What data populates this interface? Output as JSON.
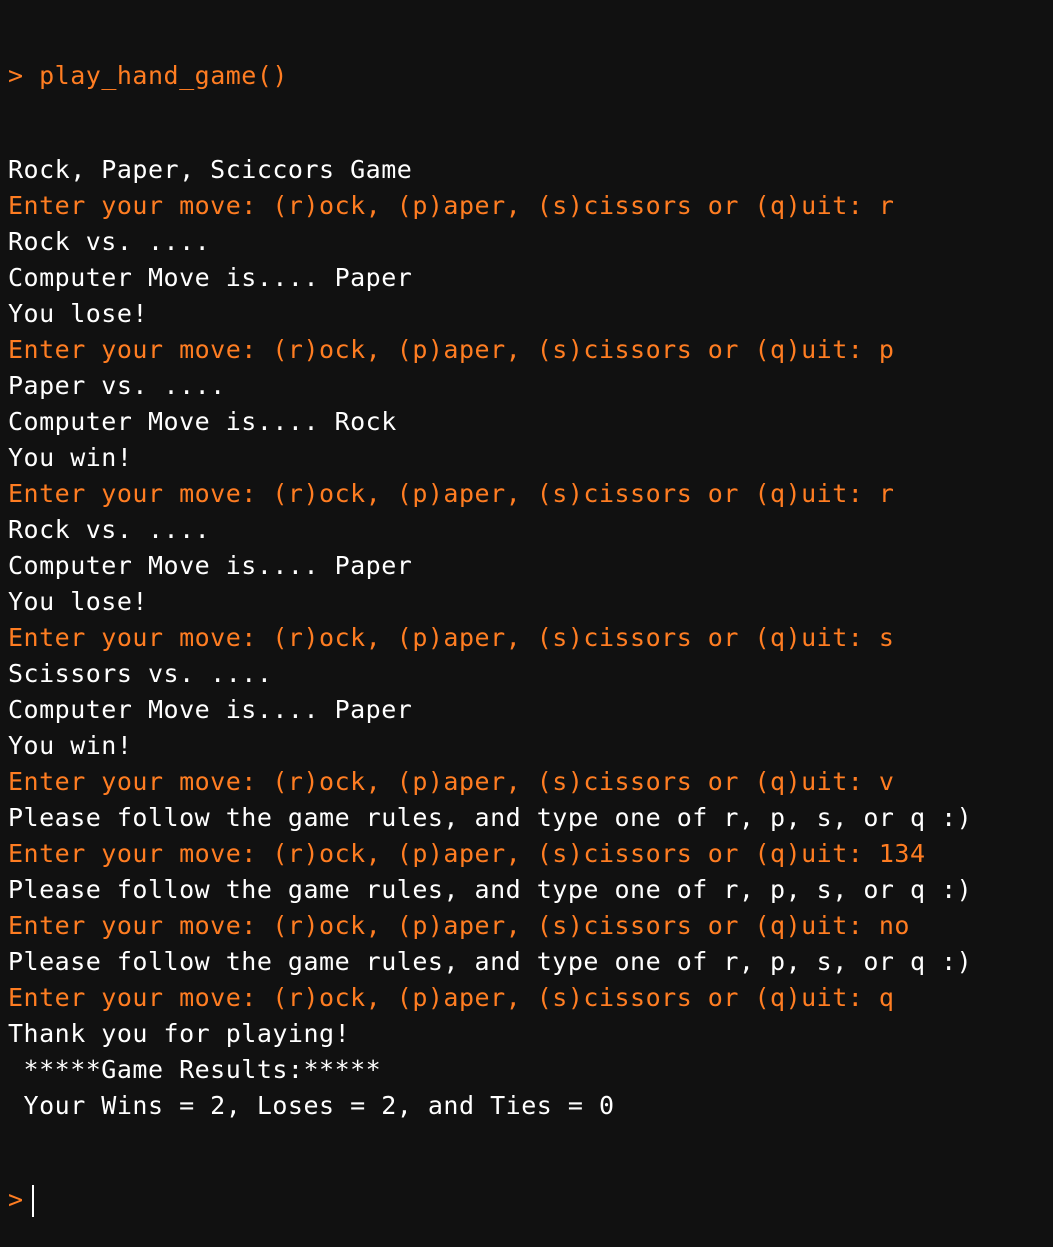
{
  "console": {
    "prompt_symbol": ">",
    "command": "play_hand_game()",
    "lines": [
      {
        "kind": "out",
        "text": "Rock, Paper, Sciccors Game"
      },
      {
        "kind": "prompt",
        "text": "Enter your move: (r)ock, (p)aper, (s)cissors or (q)uit: r"
      },
      {
        "kind": "out",
        "text": "Rock vs. ...."
      },
      {
        "kind": "out",
        "text": "Computer Move is.... Paper"
      },
      {
        "kind": "out",
        "text": "You lose!"
      },
      {
        "kind": "prompt",
        "text": "Enter your move: (r)ock, (p)aper, (s)cissors or (q)uit: p"
      },
      {
        "kind": "out",
        "text": "Paper vs. ...."
      },
      {
        "kind": "out",
        "text": "Computer Move is.... Rock"
      },
      {
        "kind": "out",
        "text": "You win!"
      },
      {
        "kind": "prompt",
        "text": "Enter your move: (r)ock, (p)aper, (s)cissors or (q)uit: r"
      },
      {
        "kind": "out",
        "text": "Rock vs. ...."
      },
      {
        "kind": "out",
        "text": "Computer Move is.... Paper"
      },
      {
        "kind": "out",
        "text": "You lose!"
      },
      {
        "kind": "prompt",
        "text": "Enter your move: (r)ock, (p)aper, (s)cissors or (q)uit: s"
      },
      {
        "kind": "out",
        "text": "Scissors vs. ...."
      },
      {
        "kind": "out",
        "text": "Computer Move is.... Paper"
      },
      {
        "kind": "out",
        "text": "You win!"
      },
      {
        "kind": "prompt",
        "text": "Enter your move: (r)ock, (p)aper, (s)cissors or (q)uit: v"
      },
      {
        "kind": "out",
        "text": "Please follow the game rules, and type one of r, p, s, or q :)"
      },
      {
        "kind": "prompt",
        "text": "Enter your move: (r)ock, (p)aper, (s)cissors or (q)uit: 134"
      },
      {
        "kind": "out",
        "text": "Please follow the game rules, and type one of r, p, s, or q :)"
      },
      {
        "kind": "prompt",
        "text": "Enter your move: (r)ock, (p)aper, (s)cissors or (q)uit: no"
      },
      {
        "kind": "out",
        "text": "Please follow the game rules, and type one of r, p, s, or q :)"
      },
      {
        "kind": "prompt",
        "text": "Enter your move: (r)ock, (p)aper, (s)cissors or (q)uit: q"
      },
      {
        "kind": "out",
        "text": "Thank you for playing!"
      },
      {
        "kind": "out",
        "text": " *****Game Results:*****"
      },
      {
        "kind": "out",
        "text": " Your Wins = 2, Loses = 2, and Ties = 0"
      }
    ],
    "final_prompt": ">"
  },
  "colors": {
    "background": "#111111",
    "prompt_accent": "#ff7d22",
    "output_text": "#ffffff"
  }
}
